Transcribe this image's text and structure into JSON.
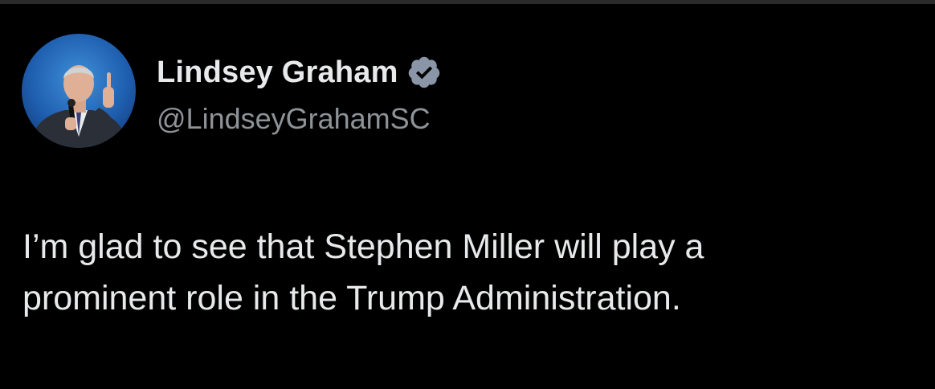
{
  "tweet": {
    "author": {
      "display_name": "Lindsey Graham",
      "handle": "@LindseyGrahamSC",
      "verified": true,
      "verified_icon": "verified-badge-icon",
      "avatar": "profile-photo"
    },
    "text_line_1": "I’m glad to see that Stephen Miller will play a",
    "text_line_2": "prominent role in the Trump Administration."
  },
  "colors": {
    "background": "#000000",
    "text_primary": "#e7e9ea",
    "text_secondary": "#8e9398",
    "verified_badge": "#8a96a8"
  }
}
